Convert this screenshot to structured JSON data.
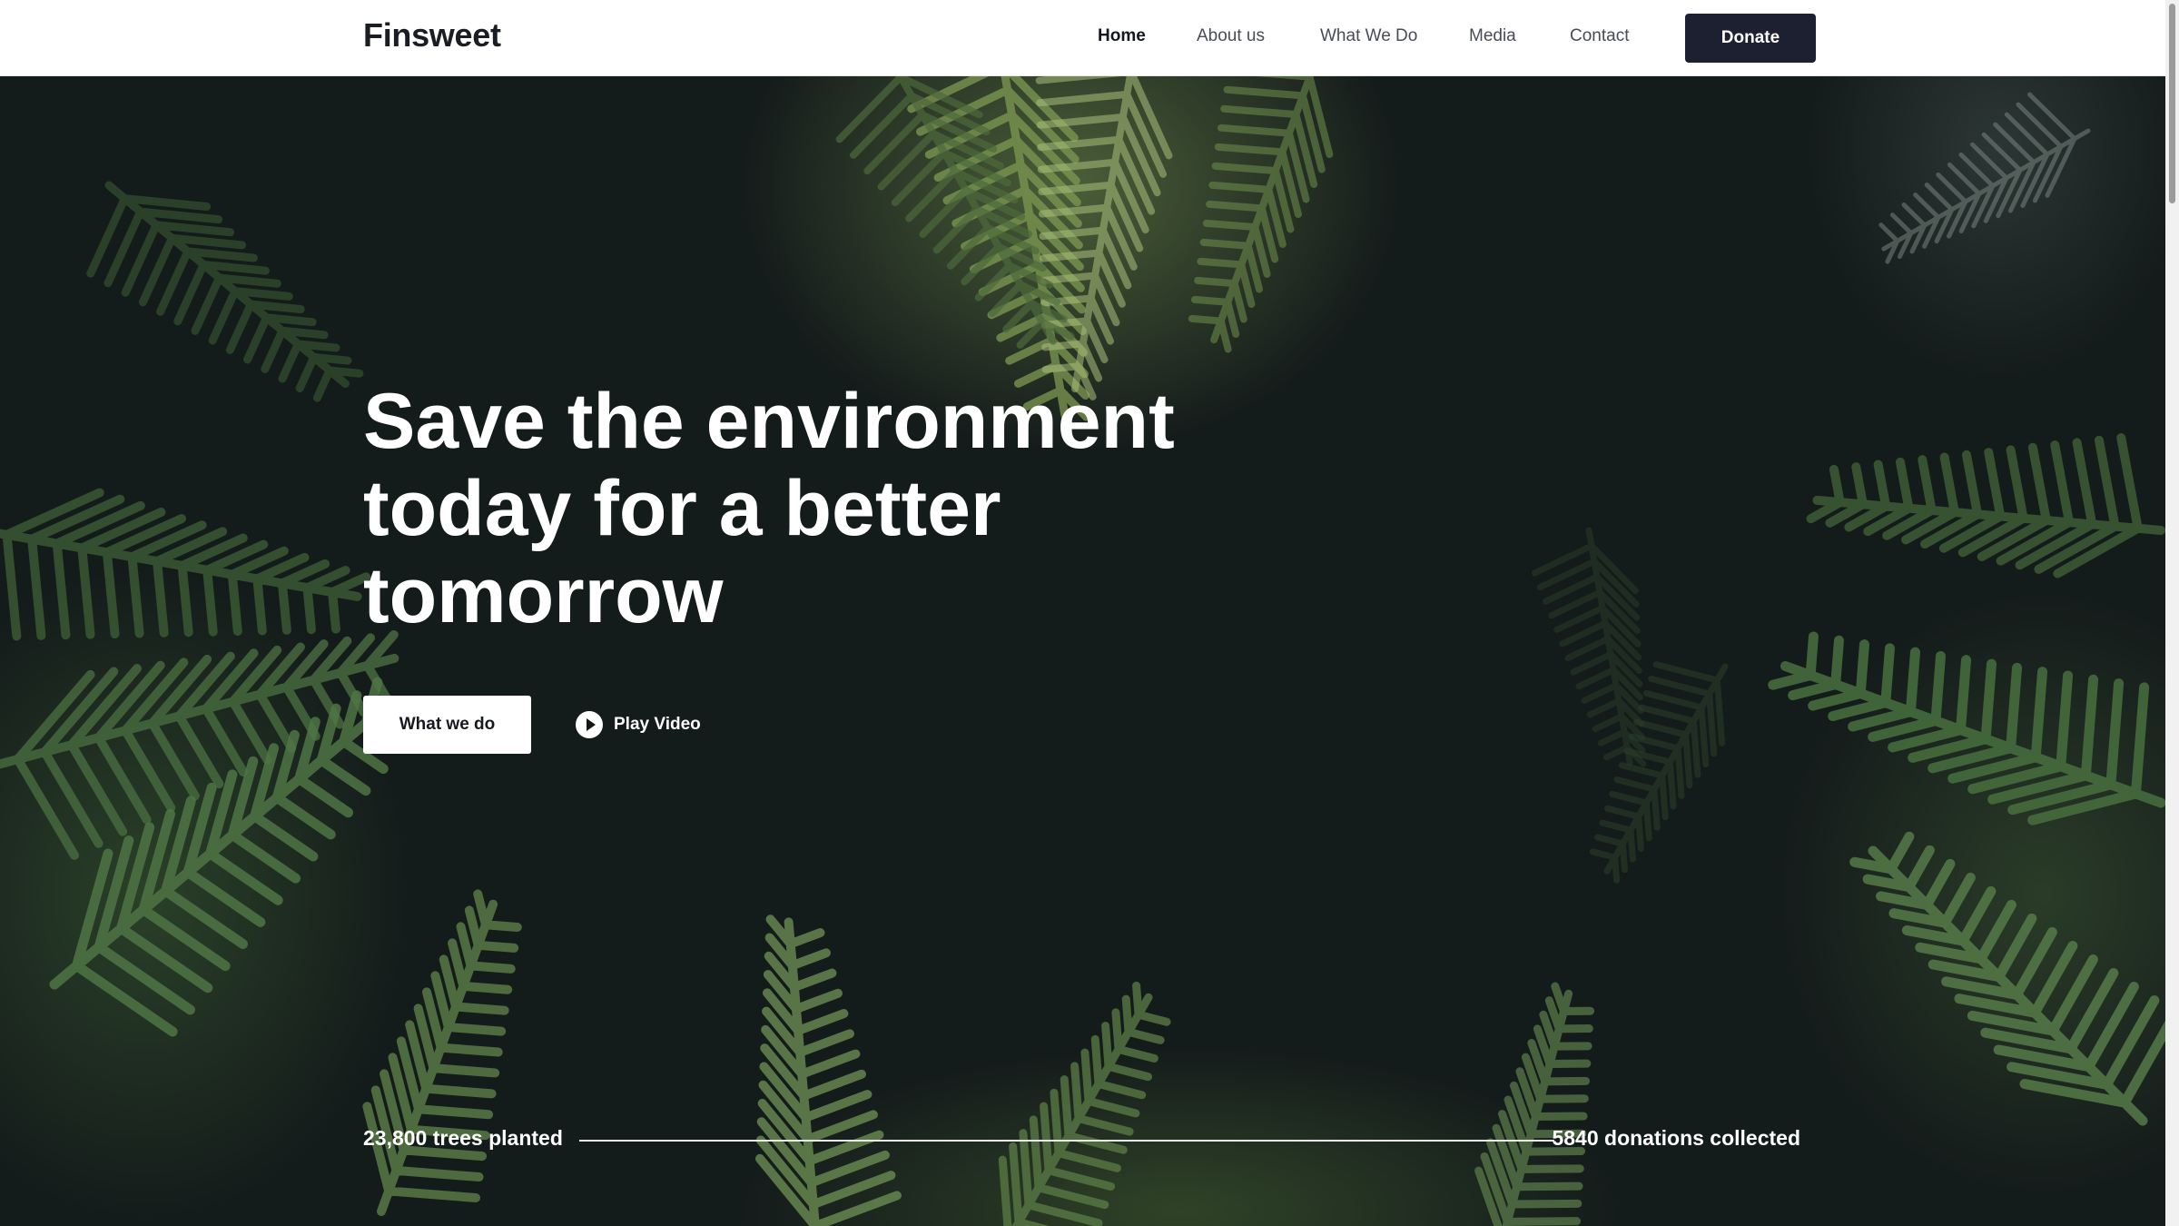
{
  "header": {
    "logo": "Finsweet",
    "nav": [
      {
        "label": "Home",
        "active": true
      },
      {
        "label": "About us",
        "active": false
      },
      {
        "label": "What We Do",
        "active": false
      },
      {
        "label": "Media",
        "active": false
      },
      {
        "label": "Contact",
        "active": false
      }
    ],
    "donate_label": "Donate"
  },
  "hero": {
    "title_lines": [
      "Save the environment",
      "today for a better",
      "tomorrow"
    ],
    "primary_cta": "What we do",
    "video_cta": "Play Video",
    "stats": {
      "left": "23,800 trees planted",
      "right": "5840 donations collected"
    }
  },
  "colors": {
    "header_bg": "#ffffff",
    "donate_bg": "#1d2030",
    "hero_bg": "#141b1b",
    "foliage": "#3f5f36",
    "text_light": "#ffffff"
  },
  "icons": {
    "play": "play-circle-icon"
  }
}
